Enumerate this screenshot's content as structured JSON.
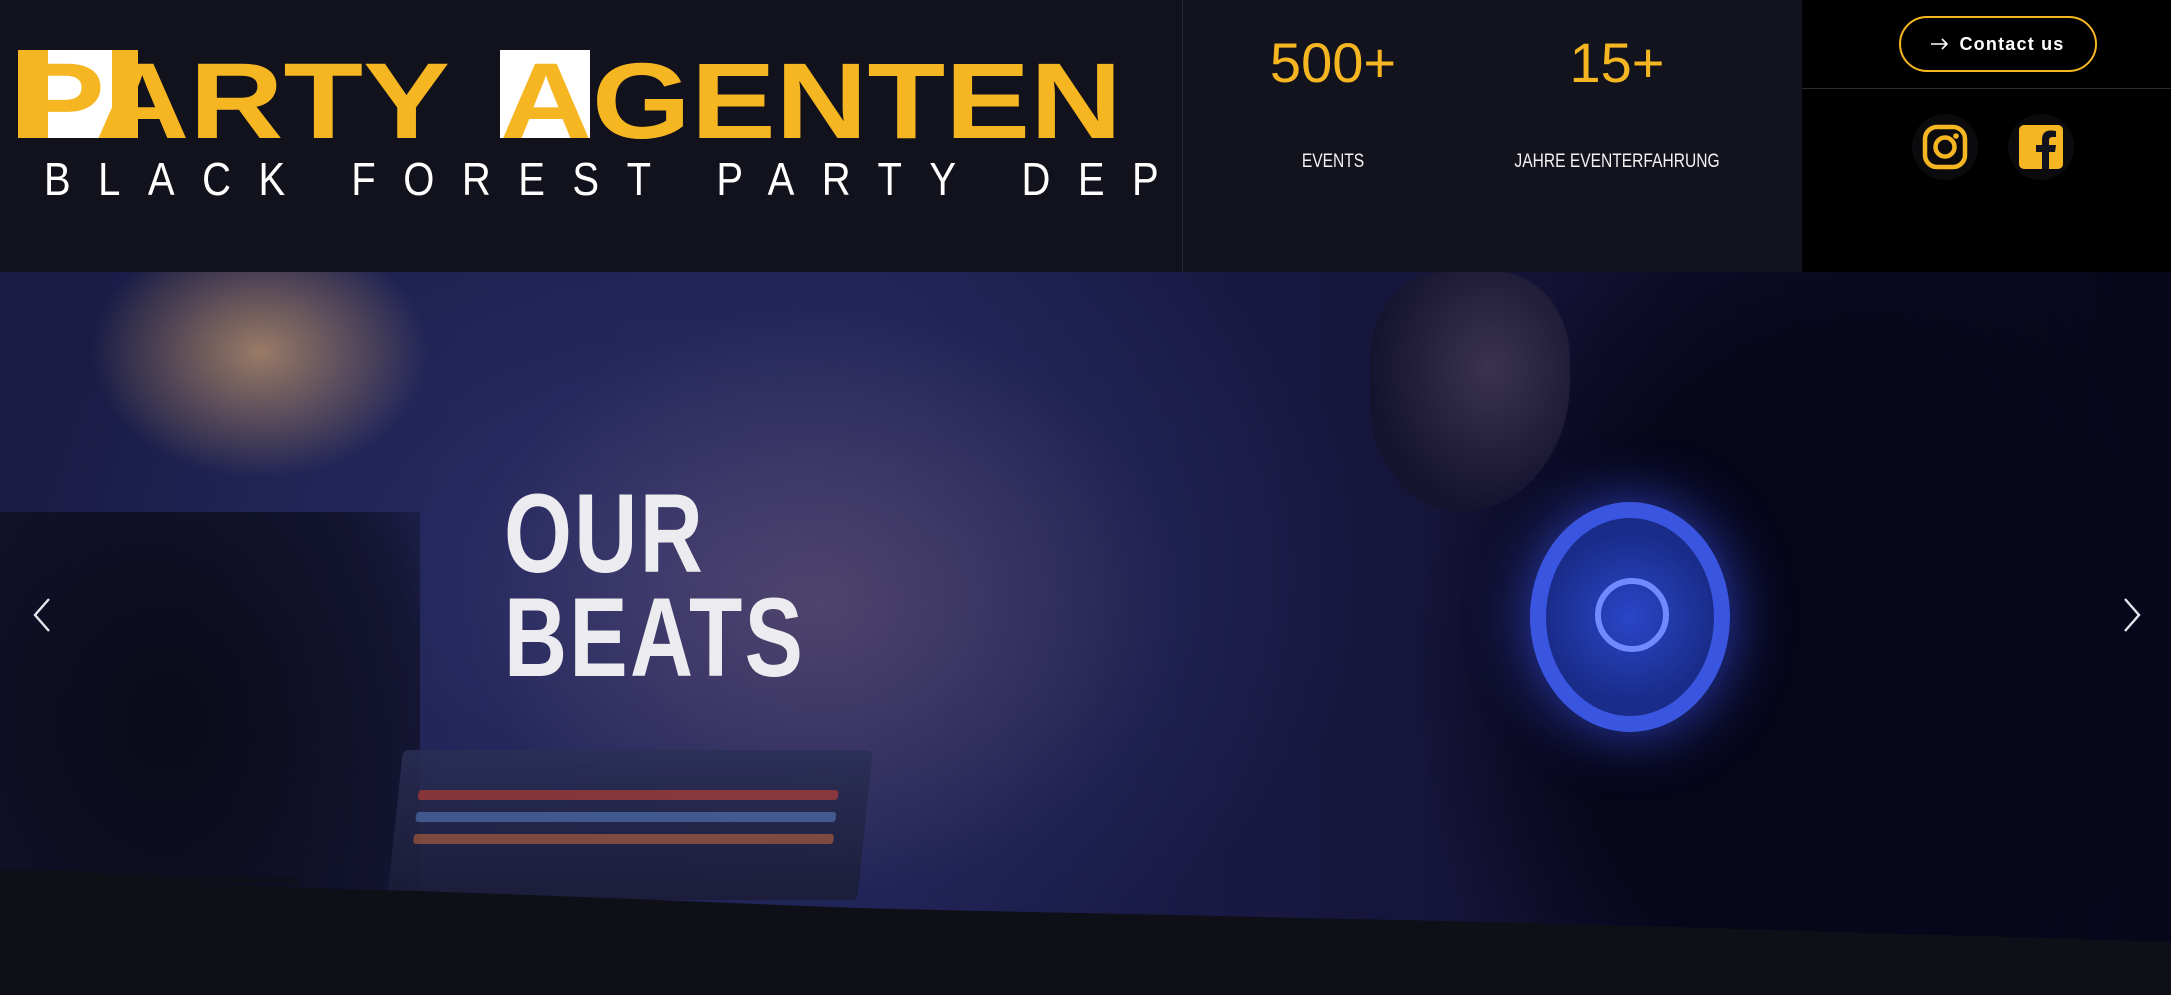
{
  "brand": {
    "name_part1": "PARTY",
    "name_part2": "AGENTEN",
    "subtitle": "BLACK FOREST PARTY DEPARTMENT",
    "accent_color": "#f5b622"
  },
  "stats": [
    {
      "number": "500+",
      "label": "EVENTS"
    },
    {
      "number": "15+",
      "label": "JAHRE EVENTERFAHRUNG"
    }
  ],
  "header": {
    "contact_label": "Contact us",
    "contact_icon": "arrow-right-icon"
  },
  "social": [
    {
      "icon": "instagram-icon"
    },
    {
      "icon": "facebook-icon"
    }
  ],
  "hero": {
    "title_line1": "OUR",
    "title_line2": "BEATS",
    "prev_icon": "chevron-left-icon",
    "next_icon": "chevron-right-icon"
  }
}
